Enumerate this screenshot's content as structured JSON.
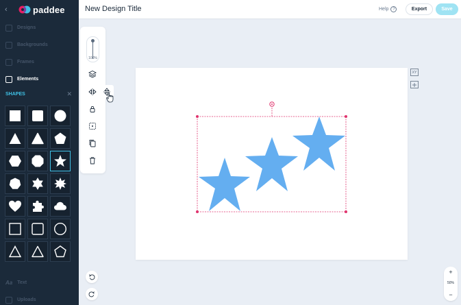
{
  "app": {
    "logo_text": "paddee",
    "brand_color": "#e91e63",
    "accent": "#3fc1e6"
  },
  "header": {
    "title": "New Design Title",
    "help_label": "Help",
    "export_label": "Export",
    "save_label": "Save"
  },
  "sidebar": {
    "nav": [
      {
        "label": "Designs",
        "icon": "designs-icon"
      },
      {
        "label": "Backgrounds",
        "icon": "backgrounds-icon"
      },
      {
        "label": "Frames",
        "icon": "frames-icon"
      },
      {
        "label": "Elements",
        "icon": "elements-icon",
        "active": true
      }
    ],
    "section_title": "SHAPES",
    "shapes": [
      "square",
      "rounded-square",
      "circle",
      "triangle",
      "rounded-triangle",
      "pentagon",
      "hexagon",
      "octagon",
      "star",
      "heptagon",
      "six-point-star",
      "burst-star",
      "heart",
      "puzzle-piece",
      "cloud",
      "square-outline",
      "rounded-square-outline",
      "circle-outline",
      "triangle-outline",
      "rounded-triangle-outline",
      "pentagon-outline"
    ],
    "selected_shape": "star",
    "bottom_nav": [
      {
        "label": "Text",
        "icon": "text-icon"
      },
      {
        "label": "Uploads",
        "icon": "uploads-icon"
      }
    ]
  },
  "tools": {
    "zoom_label": "100%"
  },
  "canvas": {
    "side_labels": {
      "xy": "XY"
    },
    "shape_color": "#64aef0",
    "selection_color": "#e0336d"
  },
  "zoom": {
    "plus": "+",
    "percent": "50%",
    "minus": "−"
  }
}
